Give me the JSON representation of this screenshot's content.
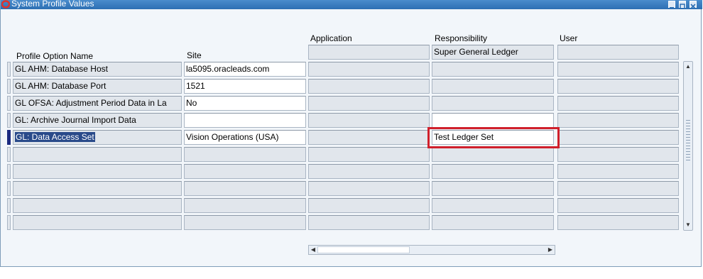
{
  "window": {
    "title": "System Profile Values"
  },
  "columns": {
    "profile_option_name": "Profile Option Name",
    "site": "Site",
    "application": "Application",
    "responsibility": "Responsibility",
    "user": "User"
  },
  "level_values": {
    "application": "",
    "responsibility": "Super General Ledger",
    "user": ""
  },
  "rows": [
    {
      "name": "GL AHM: Database Host",
      "site": "la5095.oracleads.com",
      "application": "",
      "responsibility": "",
      "user": ""
    },
    {
      "name": "GL AHM: Database Port",
      "site": "1521",
      "application": "",
      "responsibility": "",
      "user": ""
    },
    {
      "name": "GL OFSA: Adjustment Period Data in La",
      "site": "No",
      "application": "",
      "responsibility": "",
      "user": ""
    },
    {
      "name": "GL: Archive Journal Import Data",
      "site": "",
      "application": "",
      "responsibility": "",
      "user": ""
    },
    {
      "name": "GL: Data Access Set",
      "site": "Vision Operations (USA)",
      "application": "",
      "responsibility": "Test Ledger Set",
      "user": ""
    },
    {
      "name": "",
      "site": "",
      "application": "",
      "responsibility": "",
      "user": ""
    },
    {
      "name": "",
      "site": "",
      "application": "",
      "responsibility": "",
      "user": ""
    },
    {
      "name": "",
      "site": "",
      "application": "",
      "responsibility": "",
      "user": ""
    },
    {
      "name": "",
      "site": "",
      "application": "",
      "responsibility": "",
      "user": ""
    },
    {
      "name": "",
      "site": "",
      "application": "",
      "responsibility": "",
      "user": ""
    }
  ],
  "selected_row": 4,
  "colors": {
    "titlebar": "#2d6fb3",
    "selection": "#294a8a",
    "highlight_box": "#d0202c"
  }
}
